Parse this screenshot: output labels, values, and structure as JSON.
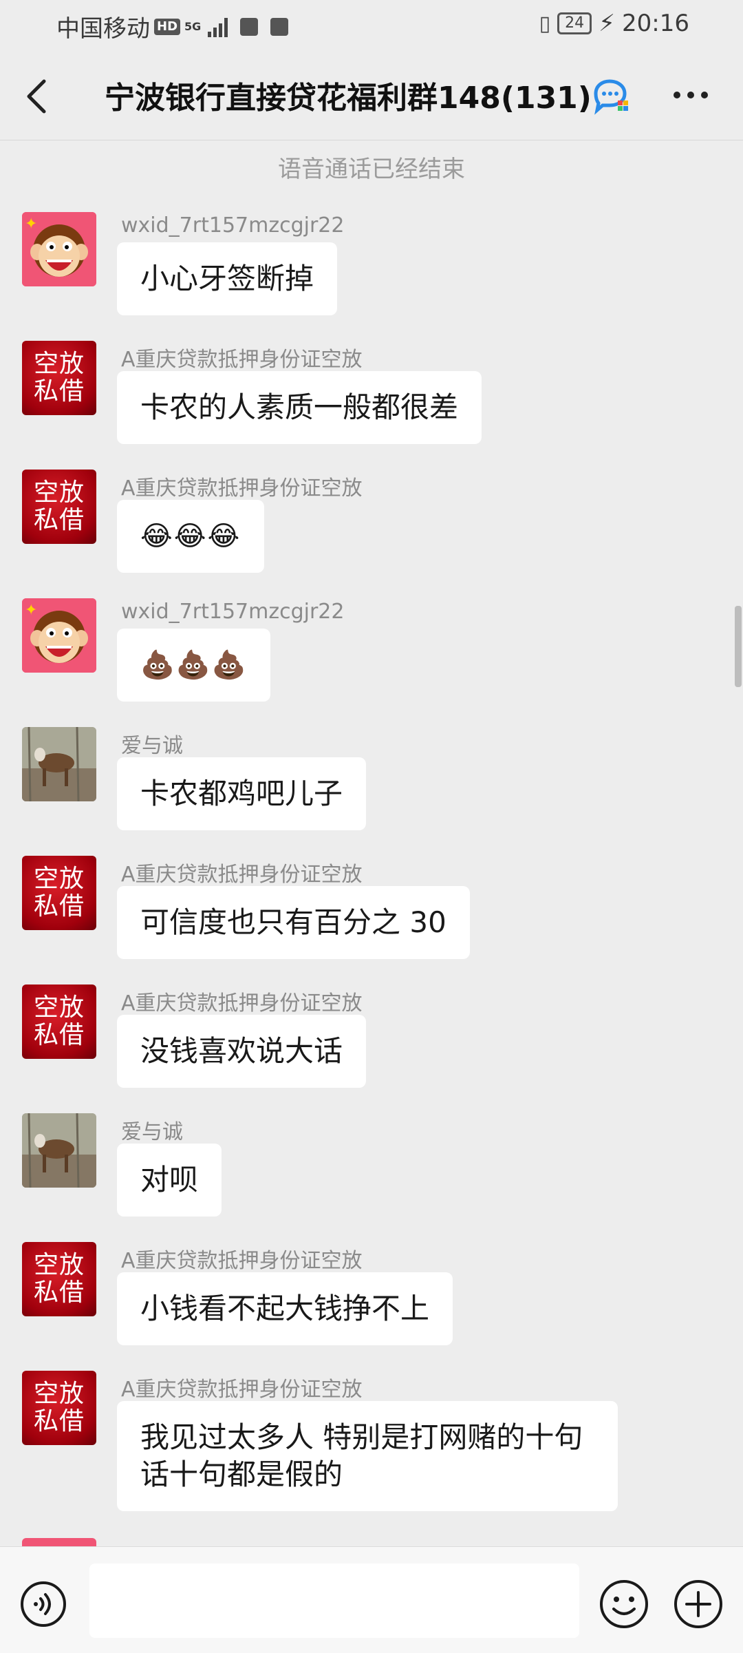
{
  "status_bar": {
    "carrier": "中国移动",
    "hd": "HD",
    "network": "5G",
    "battery": "24",
    "time": "20:16"
  },
  "header": {
    "title": "宁波银行直接贷花福利群148(131)",
    "back_icon": "chevron-left-icon",
    "more_icon": "more-horizontal-icon"
  },
  "system_message": "语音通话已经结束",
  "avatar_text": {
    "line1": "空放",
    "line2": "私借"
  },
  "messages": [
    {
      "sender": "wxid_7rt157mzcgjr22",
      "text": "小心牙签断掉",
      "avatar": "monkey"
    },
    {
      "sender": "A重庆贷款抵押身份证空放",
      "text": "卡农的人素质一般都很差",
      "avatar": "red"
    },
    {
      "sender": "A重庆贷款抵押身份证空放",
      "text": "😂😂😂",
      "avatar": "red"
    },
    {
      "sender": "wxid_7rt157mzcgjr22",
      "text": "💩💩💩",
      "avatar": "monkey"
    },
    {
      "sender": "爱与诚",
      "text": "卡农都鸡吧儿子",
      "avatar": "photo"
    },
    {
      "sender": "A重庆贷款抵押身份证空放",
      "text": "可信度也只有百分之 30",
      "avatar": "red"
    },
    {
      "sender": "A重庆贷款抵押身份证空放",
      "text": "没钱喜欢说大话",
      "avatar": "red"
    },
    {
      "sender": "爱与诚",
      "text": "对呗",
      "avatar": "photo"
    },
    {
      "sender": "A重庆贷款抵押身份证空放",
      "text": "小钱看不起大钱挣不上",
      "avatar": "red"
    },
    {
      "sender": "A重庆贷款抵押身份证空放",
      "text": "我见过太多人 特别是打网赌的十句话十句都是假的",
      "avatar": "red"
    }
  ],
  "input_bar": {
    "voice_icon": "voice-icon",
    "emoji_icon": "emoji-icon",
    "plus_icon": "plus-icon"
  },
  "colors": {
    "background": "#ededed",
    "bubble": "#ffffff",
    "avatar_red": "#c8101c"
  }
}
